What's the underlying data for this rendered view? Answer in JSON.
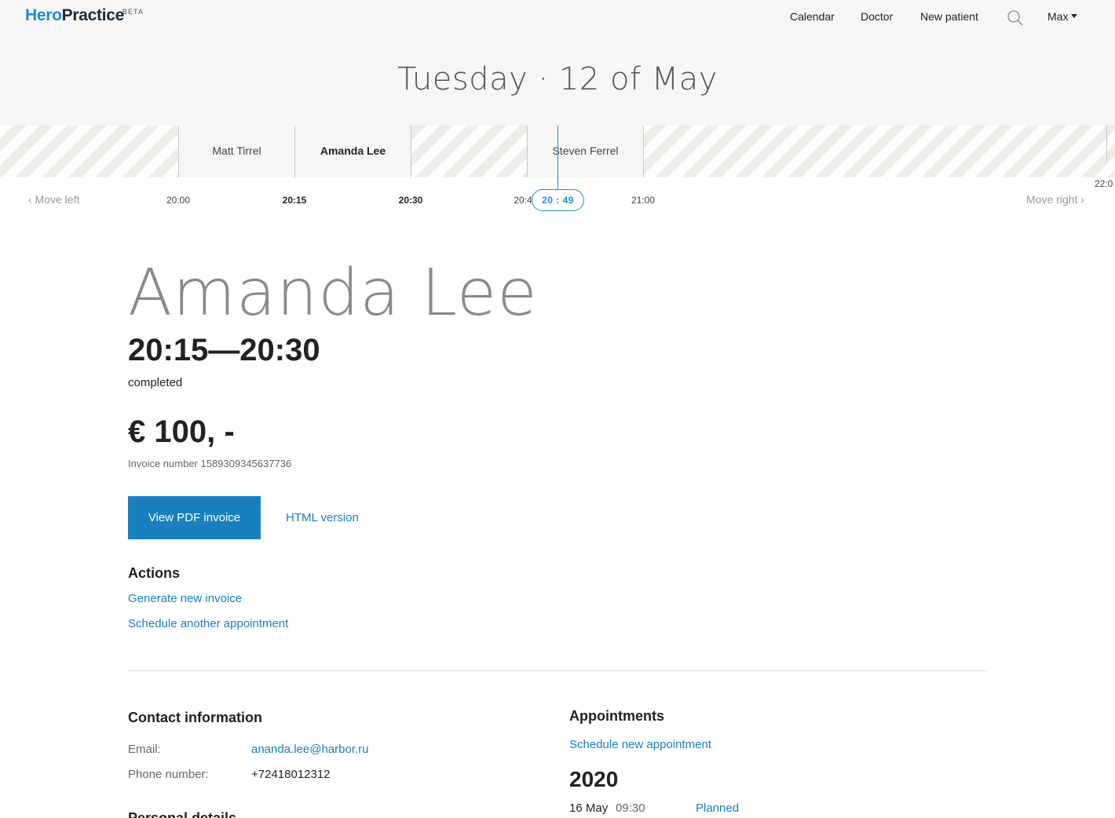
{
  "header": {
    "logo_hero": "Hero",
    "logo_practice": "Practice",
    "logo_beta": "BETA",
    "nav": {
      "calendar": "Calendar",
      "doctor": "Doctor",
      "new_patient": "New patient",
      "user": "Max"
    }
  },
  "schedule": {
    "date_day": "Tuesday",
    "date_rest": "· 12 of May",
    "columns": [
      "Matt Tirrel",
      "Amanda Lee",
      "",
      "Steven Ferrel"
    ],
    "times": [
      "20:00",
      "20:15",
      "20:30",
      "20:4",
      "21:00"
    ],
    "time_22": "22:0",
    "now": "20 : 49",
    "move_left": "‹ Move left",
    "move_right": "Move right ›"
  },
  "appointment": {
    "patient_name": "Amanda Lee",
    "time_range": "20:15—20:30",
    "status": "completed",
    "price": "€ 100, -",
    "invoice_number": "Invoice number 1589309345637736",
    "view_pdf": "View PDF invoice",
    "html_version": "HTML version"
  },
  "actions": {
    "title": "Actions",
    "generate_invoice": "Generate new invoice",
    "schedule_another": "Schedule another appointment"
  },
  "contact": {
    "title": "Contact information",
    "email_label": "Email:",
    "email_value": "ananda.lee@harbor.ru",
    "phone_label": "Phone number:",
    "phone_value": "+72418012312",
    "personal_title": "Personal details"
  },
  "appointments": {
    "title": "Appointments",
    "schedule_new": "Schedule new appointment",
    "year": "2020",
    "items": [
      {
        "date": "16 May",
        "time": "09:30",
        "status": "Planned"
      }
    ]
  },
  "colors": {
    "accent": "#1a7fbf",
    "logo_blue": "#1a8ed0",
    "header_bg": "#f7f6f4"
  }
}
